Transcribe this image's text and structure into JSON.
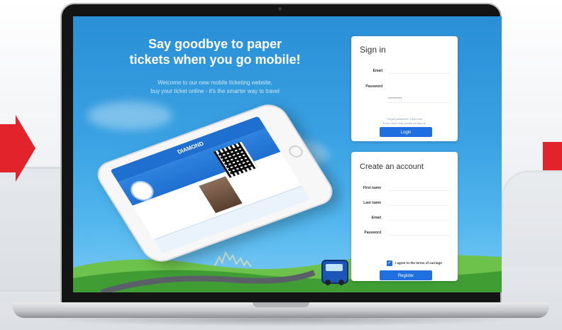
{
  "hero": {
    "headline_line1": "Say goodbye to paper",
    "headline_line2": "tickets when you go mobile!",
    "subline_line1": "Welcome to our new mobile ticketing website,",
    "subline_line2": "buy your ticket online - it's the smarter way to travel"
  },
  "phone_app": {
    "logo": "DIAMOND"
  },
  "signin": {
    "title": "Sign in",
    "email_label": "Email",
    "password_label": "Password",
    "password_placeholder": "**********",
    "forgot_text_line1": "Forgot password? Click here",
    "forgot_text_line2": "If you need help please contact us",
    "login_button": "Login"
  },
  "create_account": {
    "title": "Create an account",
    "first_name_label": "First name",
    "last_name_label": "Last name",
    "email_label": "Email",
    "password_label": "Password",
    "agree_text": "I agree to the terms of carriage",
    "agree_checked": true,
    "register_button": "Register"
  },
  "colors": {
    "accent_red": "#e3232c",
    "brand_blue": "#1f6fe0",
    "sky_blue": "#3aa2e3"
  }
}
